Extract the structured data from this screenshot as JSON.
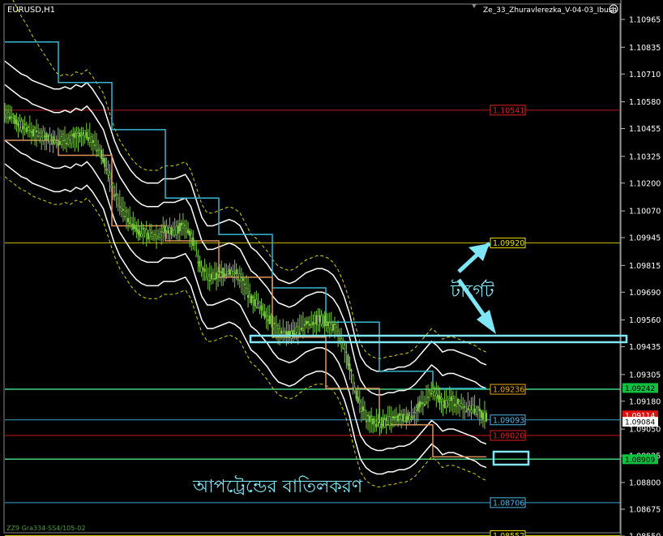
{
  "window": {
    "symbol_timeframe": "EURUSD,H1",
    "indicator_name": "Ze_33_Zhuravlerezka_V-04-03_Ibush"
  },
  "annotations": {
    "target_text": "টার্গেট",
    "cancel_text": "আপট্রেন্ডের বাতিলকরণ",
    "footer_text": "ZZ9 Gra334-SS4/105-02"
  },
  "colors": {
    "background": "#000000",
    "candle": "#7ac943",
    "cyan_step": "#38b8d0",
    "orange_step": "#e0925a",
    "white_band": "#ffffff",
    "yellow_dash": "#d8d000",
    "annotation": "#7fe6f5"
  },
  "chart_data": {
    "type": "line",
    "symbol": "EURUSD",
    "timeframe": "H1",
    "y_ticks": [
      "1.10965",
      "1.10835",
      "1.10710",
      "1.10580",
      "1.10455",
      "1.10325",
      "1.10200",
      "1.10070",
      "1.09945",
      "1.09815",
      "1.09690",
      "1.09560",
      "1.09435",
      "1.09305",
      "1.09180",
      "1.09050",
      "1.08925",
      "1.08800",
      "1.08675",
      "1.08550"
    ],
    "ylim": [
      1.0853,
      1.1101
    ],
    "price_levels": [
      {
        "label": "1.10541",
        "color": "#e02020",
        "line": "#b81818"
      },
      {
        "label": "1.09920",
        "color": "#e8e000",
        "line": "#c8c000"
      },
      {
        "label": "1.09236",
        "color": "#e8a800",
        "line": "#40d080"
      },
      {
        "label": "1.09020",
        "color": "#e02020",
        "line": "#c81818"
      },
      {
        "label": "1.09093",
        "color": "#4db8e8",
        "line": "#3aa0d0"
      },
      {
        "label": "1.08706",
        "color": "#4db8e8",
        "line": "#3aa0d0"
      },
      {
        "label": "1.08552",
        "color": "#e8e000",
        "line": "#c8c000"
      }
    ],
    "right_axis_tags": [
      {
        "label": "1.09242",
        "bg": "#10c040",
        "fg": "#000000"
      },
      {
        "label": "1.09114",
        "bg": "#e01010",
        "fg": "#ffffff"
      },
      {
        "label": "1.09084",
        "bg": "#ffffff",
        "fg": "#000000"
      },
      {
        "label": "1.08909",
        "bg": "#10c040",
        "fg": "#000000"
      }
    ],
    "price_series": [
      1.1053,
      1.1051,
      1.1049,
      1.1047,
      1.1046,
      1.1044,
      1.1043,
      1.1042,
      1.1041,
      1.104,
      1.104,
      1.1041,
      1.104,
      1.1042,
      1.1041,
      1.1043,
      1.104,
      1.1036,
      1.1032,
      1.1024,
      1.1016,
      1.101,
      1.1006,
      1.1002,
      1.0999,
      1.0997,
      1.0996,
      1.0996,
      1.0996,
      1.0998,
      1.0998,
      1.0998,
      1.0999,
      1.1,
      1.0996,
      1.0988,
      1.098,
      1.0976,
      1.0976,
      1.0977,
      1.0978,
      1.0979,
      1.0978,
      1.0976,
      1.0971,
      1.0966,
      1.0964,
      1.0961,
      1.0958,
      1.0954,
      1.0951,
      1.095,
      1.0949,
      1.095,
      1.0952,
      1.0954,
      1.0955,
      1.0956,
      1.0956,
      1.0955,
      1.0953,
      1.0949,
      1.0943,
      1.0935,
      1.0924,
      1.0915,
      1.0911,
      1.0909,
      1.0908,
      1.0908,
      1.0909,
      1.0909,
      1.091,
      1.091,
      1.0911,
      1.0913,
      1.0916,
      1.0919,
      1.0922,
      1.092,
      1.0917,
      1.0918,
      1.0918,
      1.0917,
      1.0916,
      1.0915,
      1.0914,
      1.0912,
      1.0911
    ],
    "cyan_step_segments": [
      [
        [
          1.1086,
          1.1086
        ]
      ],
      [
        [
          1.1067,
          1.1067
        ]
      ],
      [
        [
          1.1045,
          1.1045
        ]
      ],
      [
        [
          1.1013,
          1.1013
        ]
      ],
      [
        [
          1.0996,
          1.0996
        ]
      ],
      [
        [
          1.0971,
          1.0971
        ]
      ],
      [
        [
          1.0955,
          1.0955
        ]
      ],
      [
        [
          1.0932,
          1.0932
        ]
      ],
      [
        [
          1.0924,
          1.0924
        ]
      ]
    ],
    "orange_step_segments": [
      [
        [
          1.104,
          1.104
        ]
      ],
      [
        [
          1.1033,
          1.1033
        ]
      ],
      [
        [
          1.1,
          1.1
        ]
      ],
      [
        [
          1.0993,
          1.0993
        ]
      ],
      [
        [
          1.0976,
          1.0976
        ]
      ],
      [
        [
          1.0948,
          1.0948
        ]
      ],
      [
        [
          1.0924,
          1.0924
        ]
      ],
      [
        [
          1.0907,
          1.0907
        ]
      ],
      [
        [
          1.0892,
          1.0892
        ]
      ]
    ],
    "grid": false,
    "legend": "none"
  }
}
